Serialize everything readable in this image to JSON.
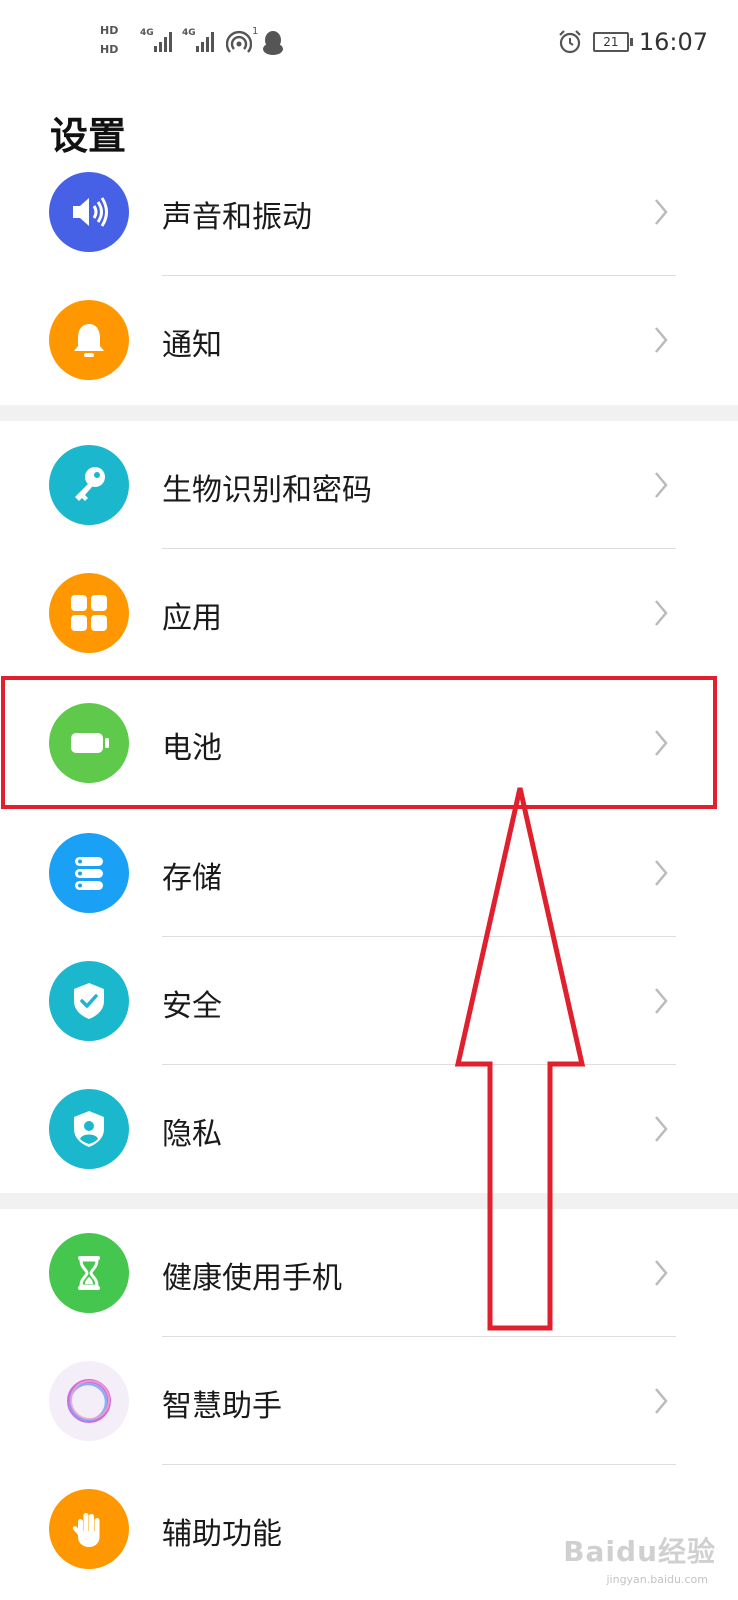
{
  "status_bar": {
    "sim1": "HD",
    "sim2": "HD",
    "net1": "4G",
    "net2": "4G",
    "hotspot_count": "1",
    "battery": "21",
    "time": "16:07"
  },
  "page_title": "设置",
  "settings": {
    "items": [
      {
        "label": "声音和振动",
        "icon": "speaker-icon",
        "color": "#4660e6"
      },
      {
        "label": "通知",
        "icon": "bell-icon",
        "color": "#ff9800"
      },
      {
        "label": "生物识别和密码",
        "icon": "key-icon",
        "color": "#1bb7cc"
      },
      {
        "label": "应用",
        "icon": "grid-icon",
        "color": "#ff9800"
      },
      {
        "label": "电池",
        "icon": "battery-icon",
        "color": "#5fc94b"
      },
      {
        "label": "存储",
        "icon": "storage-icon",
        "color": "#1aa0f5"
      },
      {
        "label": "安全",
        "icon": "shield-check-icon",
        "color": "#1bb7cc"
      },
      {
        "label": "隐私",
        "icon": "privacy-icon",
        "color": "#1bb7cc"
      },
      {
        "label": "健康使用手机",
        "icon": "hourglass-icon",
        "color": "#45c64f"
      },
      {
        "label": "智慧助手",
        "icon": "ring-icon",
        "color": "#f4eef8"
      },
      {
        "label": "辅助功能",
        "icon": "hand-icon",
        "color": "#ff9800"
      }
    ]
  },
  "annotation": {
    "color": "#e0202d"
  },
  "watermark": {
    "text": "Baidu经验",
    "sub": "jingyan.baidu.com"
  }
}
